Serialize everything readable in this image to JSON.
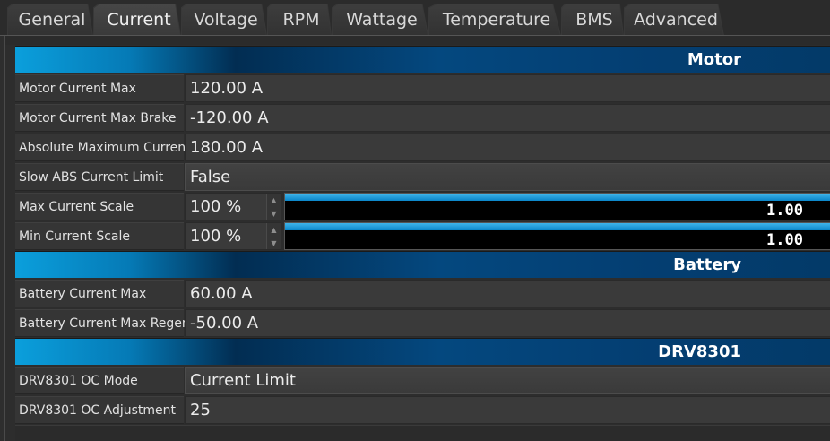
{
  "tabs": [
    {
      "label": "General",
      "active": false
    },
    {
      "label": "Current",
      "active": true
    },
    {
      "label": "Voltage",
      "active": false
    },
    {
      "label": "RPM",
      "active": false
    },
    {
      "label": "Wattage",
      "active": false
    },
    {
      "label": "Temperature",
      "active": false
    },
    {
      "label": "BMS",
      "active": false
    },
    {
      "label": "Advanced",
      "active": false
    }
  ],
  "sections": {
    "motor": {
      "title": "Motor",
      "motor_current_max": {
        "label": "Motor Current Max",
        "value": "120.00 A"
      },
      "motor_current_max_brake": {
        "label": "Motor Current Max Brake",
        "value": "-120.00 A"
      },
      "absolute_maximum_current": {
        "label": "Absolute Maximum Current",
        "value": "180.00 A"
      },
      "slow_abs_current_limit": {
        "label": "Slow ABS Current Limit",
        "value": "False"
      },
      "max_current_scale": {
        "label": "Max Current Scale",
        "value": "100 %",
        "bar_text": "1.00",
        "level": 1.0
      },
      "min_current_scale": {
        "label": "Min Current Scale",
        "value": "100 %",
        "bar_text": "1.00",
        "level": 1.0
      }
    },
    "battery": {
      "title": "Battery",
      "battery_current_max": {
        "label": "Battery Current Max",
        "value": "60.00 A"
      },
      "battery_current_max_regen": {
        "label": "Battery Current Max Regen",
        "value": "-50.00 A"
      }
    },
    "drv8301": {
      "title": "DRV8301",
      "oc_mode": {
        "label": "DRV8301 OC Mode",
        "value": "Current Limit"
      },
      "oc_adjustment": {
        "label": "DRV8301 OC Adjustment",
        "value": "25"
      }
    }
  },
  "colors": {
    "section_accent": "#0b9fdc",
    "section_dark": "#033a68",
    "bar_fill": "#0a86c9"
  },
  "icons": {
    "spin_up": "chevron-up-icon",
    "spin_down": "chevron-down-icon"
  }
}
